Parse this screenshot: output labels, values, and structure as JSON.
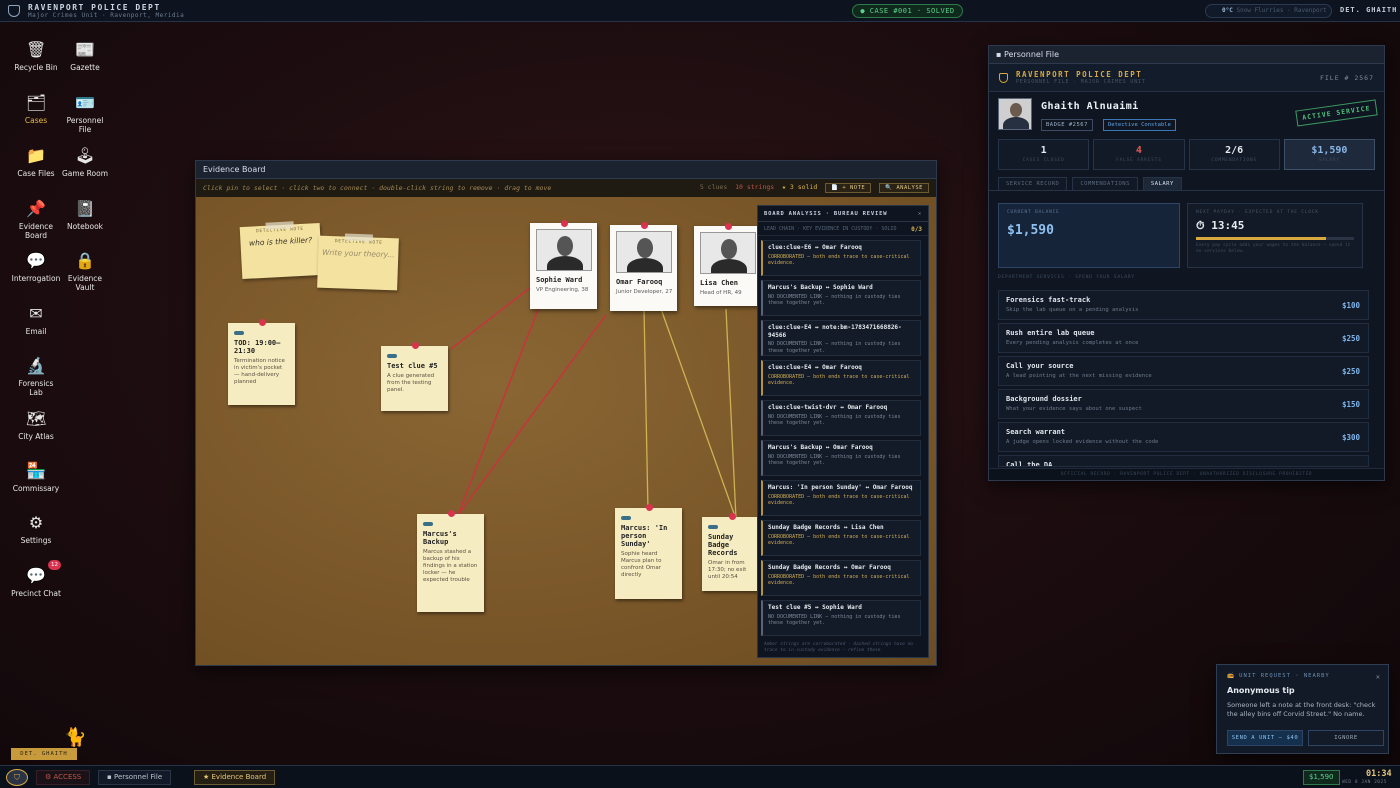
{
  "topbar": {
    "dept": "RAVENPORT POLICE DEPT",
    "unit": "Major Crimes Unit · Ravenport, Meridia",
    "case": "● CASE #001 · SOLVED",
    "temp": "0°C",
    "weather": "Snow Flurries · Ravenport",
    "user": "DET. GHAITH"
  },
  "desktop": {
    "icons": [
      {
        "label": "Recycle Bin",
        "glyph": "🗑"
      },
      {
        "label": "Gazette",
        "glyph": "📰"
      },
      {
        "label": "Cases",
        "glyph": "🗂"
      },
      {
        "label": "Personnel File",
        "glyph": "🪪"
      },
      {
        "label": "Case Files",
        "glyph": "📁"
      },
      {
        "label": "Game Room",
        "glyph": "🕹"
      },
      {
        "label": "Evidence Board",
        "glyph": "📌"
      },
      {
        "label": "Notebook",
        "glyph": "📓"
      },
      {
        "label": "Interrogation",
        "glyph": "💬"
      },
      {
        "label": "Evidence Vault",
        "glyph": "🔒"
      },
      {
        "label": "Email",
        "glyph": "✉"
      },
      {
        "label": "Forensics Lab",
        "glyph": "🔬"
      },
      {
        "label": "City Atlas",
        "glyph": "🗺"
      },
      {
        "label": "Commissary",
        "glyph": "🏪"
      },
      {
        "label": "Settings",
        "glyph": "⚙"
      },
      {
        "label": "Precinct Chat",
        "glyph": "💬"
      }
    ],
    "chat_badge": "12",
    "user_tag": "DET. GHAITH"
  },
  "evidence": {
    "title": "Evidence Board",
    "hint": "Click pin to select · click two to connect · double-click string to remove · drag to move",
    "clues": "5 clues",
    "strings": "10 strings",
    "solid": "★ 3 solid",
    "note_btn": "📄 + NOTE",
    "analyse_btn": "🔍 ANALYSE",
    "stickies": [
      {
        "label": "DETECTIVE NOTE",
        "text": "who is the killer?"
      },
      {
        "label": "DETECTIVE NOTE",
        "text": "Write your theory..."
      }
    ],
    "notes": [
      {
        "title": "TOD: 19:00–21:30",
        "body": "Termination notice in victim's pocket — hand-delivery planned"
      },
      {
        "title": "Test clue #5",
        "body": "A clue generated from the testing panel."
      },
      {
        "title": "Marcus's Backup",
        "body": "Marcus stashed a backup of his findings in a station locker — he expected trouble"
      },
      {
        "title": "Marcus: 'In person Sunday'",
        "body": "Sophie heard Marcus plan to confront Omar directly"
      },
      {
        "title": "Sunday Badge Records",
        "body": "Omar in from 17:30; no exit until 20:54"
      }
    ],
    "suspects": [
      {
        "name": "Sophie Ward",
        "role": "VP Engineering, 38"
      },
      {
        "name": "Omar Farooq",
        "role": "Junior Developer, 27"
      },
      {
        "name": "Lisa Chen",
        "role": "Head of HR, 49"
      }
    ]
  },
  "analysis": {
    "title": "BOARD ANALYSIS · BUREAU REVIEW",
    "sub": "LEAD CHAIN · KEY EVIDENCE IN CUSTODY · SOLID",
    "count": "0/3",
    "items": [
      {
        "pair": "clue:clue-E6 ↔ Omar Farooq",
        "status": "CORROBORATED — both ends trace to case-critical evidence.",
        "kind": "c"
      },
      {
        "pair": "Marcus's Backup ↔ Sophie Ward",
        "status": "NO DOCUMENTED LINK — nothing in custody ties these together yet.",
        "kind": "n"
      },
      {
        "pair": "clue:clue-E4 ↔ note:bm-1783471668826-94566",
        "status": "NO DOCUMENTED LINK — nothing in custody ties these together yet.",
        "kind": "n"
      },
      {
        "pair": "clue:clue-E4 ↔ Omar Farooq",
        "status": "CORROBORATED — both ends trace to case-critical evidence.",
        "kind": "c"
      },
      {
        "pair": "clue:clue-twist-dvr ↔ Omar Farooq",
        "status": "NO DOCUMENTED LINK — nothing in custody ties these together yet.",
        "kind": "n"
      },
      {
        "pair": "Marcus's Backup ↔ Omar Farooq",
        "status": "NO DOCUMENTED LINK — nothing in custody ties these together yet.",
        "kind": "n"
      },
      {
        "pair": "Marcus: 'In person Sunday' ↔ Omar Farooq",
        "status": "CORROBORATED — both ends trace to case-critical evidence.",
        "kind": "c"
      },
      {
        "pair": "Sunday Badge Records ↔ Lisa Chen",
        "status": "CORROBORATED — both ends trace to case-critical evidence.",
        "kind": "c"
      },
      {
        "pair": "Sunday Badge Records ↔ Omar Farooq",
        "status": "CORROBORATED — both ends trace to case-critical evidence.",
        "kind": "c"
      },
      {
        "pair": "Test clue #5 ↔ Sophie Ward",
        "status": "NO DOCUMENTED LINK — nothing in custody ties these together yet.",
        "kind": "n"
      }
    ],
    "footer": "Amber strings are corroborated · dashed strings have no trace to in-custody evidence — refine these"
  },
  "personnel": {
    "title": "Personnel File",
    "dept": "RAVENPORT POLICE DEPT",
    "dept_sub": "PERSONNEL FILE · MAJOR CRIMES UNIT",
    "file_no": "FILE # 2567",
    "name": "Ghaith Alnuaimi",
    "badge": "BADGE #2567",
    "rank": "Detective Constable",
    "status": "ACTIVE SERVICE",
    "stats": [
      {
        "v": "1",
        "l": "CASES CLOSED"
      },
      {
        "v": "4",
        "l": "FALSE ARRESTS"
      },
      {
        "v": "2/6",
        "l": "COMMENDATIONS"
      },
      {
        "v": "$1,590",
        "l": "SALARY"
      }
    ],
    "tabs": [
      "SERVICE RECORD",
      "COMMENDATIONS",
      "SALARY"
    ],
    "balance_label": "CURRENT BALANCE",
    "balance": "$1,590",
    "pay_label": "NEXT PAYDAY · EXPECTED AT THE CLOCK",
    "pay_time": "⏱ 13:45",
    "pay_progress": 0.82,
    "pay_desc": "Every pay cycle adds your wages to the balance — spend it on services below.",
    "services_label": "DEPARTMENT SERVICES · SPEND YOUR SALARY",
    "services": [
      {
        "t": "Forensics fast-track",
        "d": "Skip the lab queue on a pending analysis",
        "p": "$100"
      },
      {
        "t": "Rush entire lab queue",
        "d": "Every pending analysis completes at once",
        "p": "$250"
      },
      {
        "t": "Call your source",
        "d": "A lead pointing at the next missing evidence",
        "p": "$250"
      },
      {
        "t": "Background dossier",
        "d": "What your evidence says about one suspect",
        "p": "$150"
      },
      {
        "t": "Search warrant",
        "d": "A judge opens locked evidence without the code",
        "p": "$300"
      },
      {
        "t": "Call the DA",
        "d": "",
        "p": ""
      }
    ],
    "footer": "OFFICIAL RECORD · RAVENPORT POLICE DEPT · UNAUTHORIZED DISCLOSURE PROHIBITED"
  },
  "tip": {
    "head": "📻 UNIT REQUEST · NEARBY",
    "title": "Anonymous tip",
    "body": "Someone left a note at the front desk: \"check the alley bins off Corvid Street.\" No name.",
    "send": "SEND A UNIT — $40",
    "ignore": "IGNORE"
  },
  "taskbar": {
    "access": "⚙ ACCESS",
    "tabs": [
      "Personnel File",
      "★ Evidence Board"
    ],
    "money": "$1,590",
    "clock": "01:34",
    "date": "WED 8 JAN 2025"
  }
}
